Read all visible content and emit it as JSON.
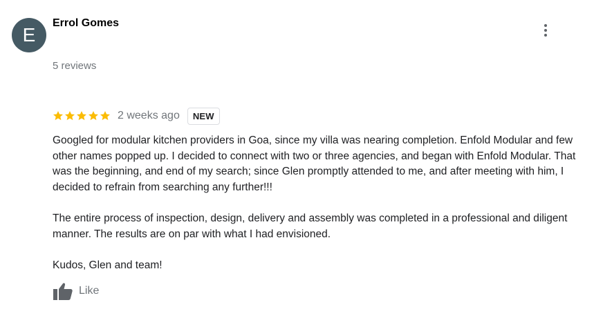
{
  "reviewer": {
    "initial": "E",
    "name": "Errol Gomes",
    "reviews_count": "5 reviews",
    "avatar_color": "#455a64"
  },
  "review": {
    "rating": 5,
    "max_rating": 5,
    "star_color": "#fbbc04",
    "time": "2 weeks ago",
    "badge": "NEW",
    "paragraphs": [
      "Googled for modular kitchen providers in Goa, since my villa was nearing completion. Enfold Modular and few other names popped up. I decided to connect with two or three agencies, and began with Enfold Modular. That was the beginning, and end of my search; since Glen promptly attended to me, and after meeting with him, I decided to refrain from searching any further!!!",
      "The entire process of inspection, design, delivery and assembly was completed in a professional and diligent manner. The results are on par with what I had envisioned.",
      "Kudos, Glen and team!"
    ]
  },
  "actions": {
    "like_label": "Like",
    "like_icon": "thumbs-up-icon",
    "menu_icon": "more-vert-icon"
  }
}
